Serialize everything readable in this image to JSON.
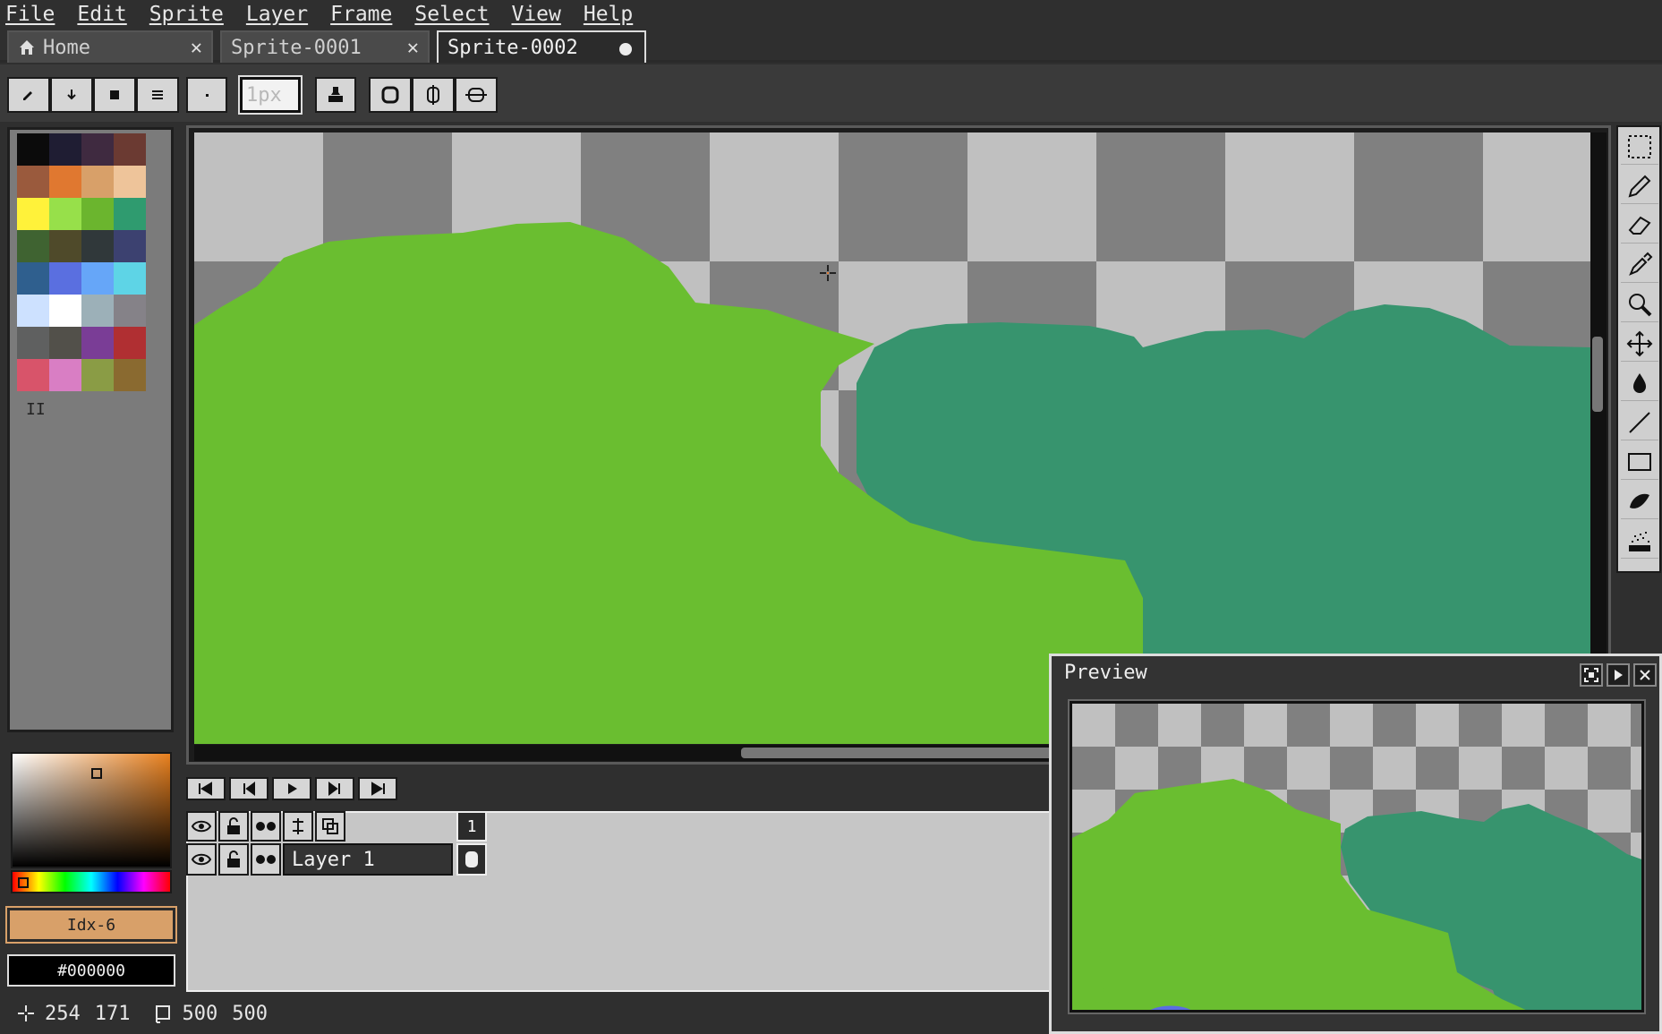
{
  "menu": [
    "File",
    "Edit",
    "Sprite",
    "Layer",
    "Frame",
    "Select",
    "View",
    "Help"
  ],
  "tabs": [
    {
      "label": "Home",
      "icon": "home-icon",
      "close": "✕"
    },
    {
      "label": "Sprite-0001",
      "close": "✕"
    },
    {
      "label": "Sprite-0002",
      "modified": true
    }
  ],
  "toolbar": {
    "brush_size_placeholder": "1px",
    "icons": [
      "pencil-icon",
      "arrow-down-icon",
      "square-icon",
      "lines-icon",
      "dot-icon",
      "stamp-icon",
      "circle-icon",
      "pivot-icon",
      "ink-icon"
    ]
  },
  "palette": [
    "#0b0b0b",
    "#1f1d33",
    "#3f2a40",
    "#6b3a32",
    "#9a5a3d",
    "#e07830",
    "#d8a069",
    "#eec49a",
    "#fff23a",
    "#97e04a",
    "#6bb52e",
    "#2f9b6f",
    "#3f6331",
    "#4f4a2a",
    "#30383a",
    "#3c4170",
    "#2f5f8e",
    "#5a6fe0",
    "#66a6f8",
    "#5ed4e6",
    "#cde1ff",
    "#ffffff",
    "#9cb0b8",
    "#858288",
    "#5f6060",
    "#52504a",
    "#7a3d96",
    "#b02f32",
    "#d8546a",
    "#d97ec4",
    "#8a9c45",
    "#8a6a30"
  ],
  "color": {
    "index_label": "Idx-6",
    "hex_label": "#000000",
    "picker_base": "#e8801e"
  },
  "tools": [
    "rectangle-select-icon",
    "pencil-icon",
    "eraser-icon",
    "eyedropper-icon",
    "zoom-icon",
    "move-icon",
    "fill-icon",
    "line-icon",
    "rectangle-icon",
    "blur-icon",
    "spray-icon"
  ],
  "timeline": {
    "controls": [
      "first-frame-icon",
      "prev-frame-icon",
      "play-icon",
      "next-frame-icon",
      "last-frame-icon"
    ],
    "frame_number": "1",
    "layer_name": "Layer 1"
  },
  "preview": {
    "title": "Preview"
  },
  "status": {
    "cursor_x": "254",
    "cursor_y": "171",
    "sprite_w": "500",
    "sprite_h": "500"
  },
  "colors": {
    "grass": "#6abe30",
    "bush": "#37946e",
    "checker_dark": "#808080",
    "checker_light": "#c0c0c0",
    "water": "#5b6ee1"
  }
}
